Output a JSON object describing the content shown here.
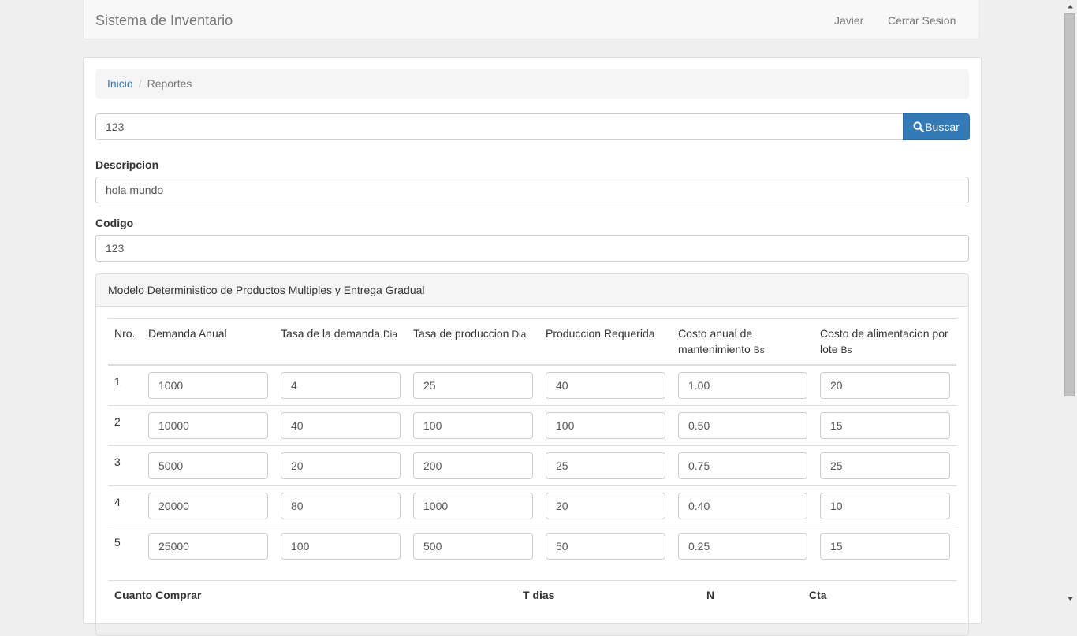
{
  "navbar": {
    "brand": "Sistema de Inventario",
    "user": "Javier",
    "logout": "Cerrar Sesion"
  },
  "breadcrumb": {
    "home": "Inicio",
    "separator": "/",
    "current": "Reportes"
  },
  "search": {
    "value": "123",
    "button_label": "Buscar"
  },
  "form": {
    "descripcion_label": "Descripcion",
    "descripcion_value": "hola mundo",
    "codigo_label": "Codigo",
    "codigo_value": "123"
  },
  "model": {
    "title": "Modelo Deterministico de Productos Multiples y Entrega Gradual",
    "headers": {
      "nro": "Nro.",
      "demanda": "Demanda Anual",
      "tasa_demanda": "Tasa de la demanda",
      "tasa_demanda_unit": "Dia",
      "tasa_produccion": "Tasa de produccion",
      "tasa_produccion_unit": "Dia",
      "produccion": "Produccion Requerida",
      "costo_mant": "Costo anual de mantenimiento",
      "costo_mant_unit": "Bs",
      "costo_alim": "Costo de alimentacion por lote",
      "costo_alim_unit": "Bs"
    },
    "rows": [
      {
        "nro": "1",
        "demanda": "1000",
        "tasa_demanda": "4",
        "tasa_produccion": "25",
        "produccion": "40",
        "costo_mant": "1.00",
        "costo_alim": "20"
      },
      {
        "nro": "2",
        "demanda": "10000",
        "tasa_demanda": "40",
        "tasa_produccion": "100",
        "produccion": "100",
        "costo_mant": "0.50",
        "costo_alim": "15"
      },
      {
        "nro": "3",
        "demanda": "5000",
        "tasa_demanda": "20",
        "tasa_produccion": "200",
        "produccion": "25",
        "costo_mant": "0.75",
        "costo_alim": "25"
      },
      {
        "nro": "4",
        "demanda": "20000",
        "tasa_demanda": "80",
        "tasa_produccion": "1000",
        "produccion": "20",
        "costo_mant": "0.40",
        "costo_alim": "10"
      },
      {
        "nro": "5",
        "demanda": "25000",
        "tasa_demanda": "100",
        "tasa_produccion": "500",
        "produccion": "50",
        "costo_mant": "0.25",
        "costo_alim": "15"
      }
    ],
    "summary": {
      "cuanto": "Cuanto Comprar",
      "t_dias": "T dias",
      "n": "N",
      "cta": "Cta"
    }
  },
  "colors": {
    "primary": "#337ab7",
    "link": "#337ab7",
    "navbar_bg": "#f8f8f8",
    "panel_head_bg": "#f5f5f5"
  },
  "icons": {
    "search_button": "search-icon"
  }
}
